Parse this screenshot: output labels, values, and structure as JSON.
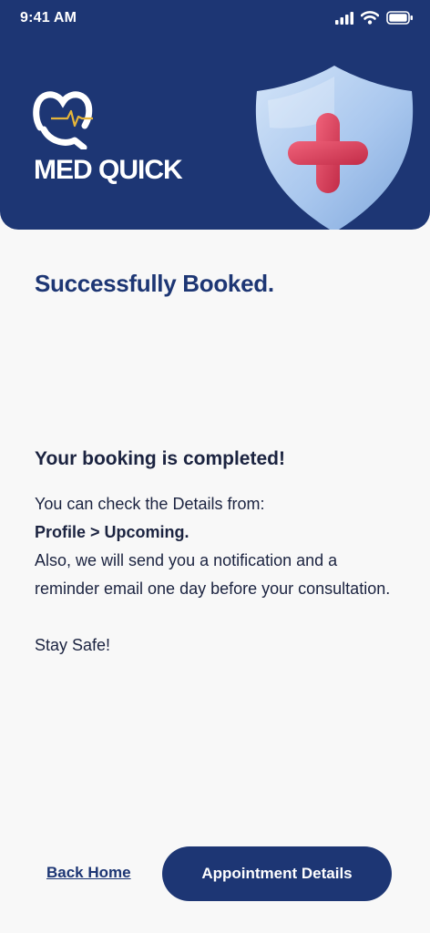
{
  "status_bar": {
    "time": "9:41 AM",
    "icons": [
      "signal-icon",
      "wifi-icon",
      "battery-icon"
    ]
  },
  "header": {
    "brand_name": "MED QUICK",
    "logo_icon": "med-quick-logo-icon",
    "illustration": "shield-medical-cross-icon"
  },
  "main": {
    "title": "Successfully Booked.",
    "heading": "Your booking is completed!",
    "line1": "You can check the Details from:",
    "path": "Profile > Upcoming.",
    "line3": "Also, we will send you a notification and a reminder email one day before your consultation.",
    "closing": "Stay Safe!"
  },
  "actions": {
    "back_home_label": "Back Home",
    "appointment_details_label": "Appointment Details"
  },
  "colors": {
    "primary": "#1d3674",
    "background": "#f8f8f8",
    "accent_red": "#d83a55",
    "shield_blue": "#a9c7ee"
  }
}
